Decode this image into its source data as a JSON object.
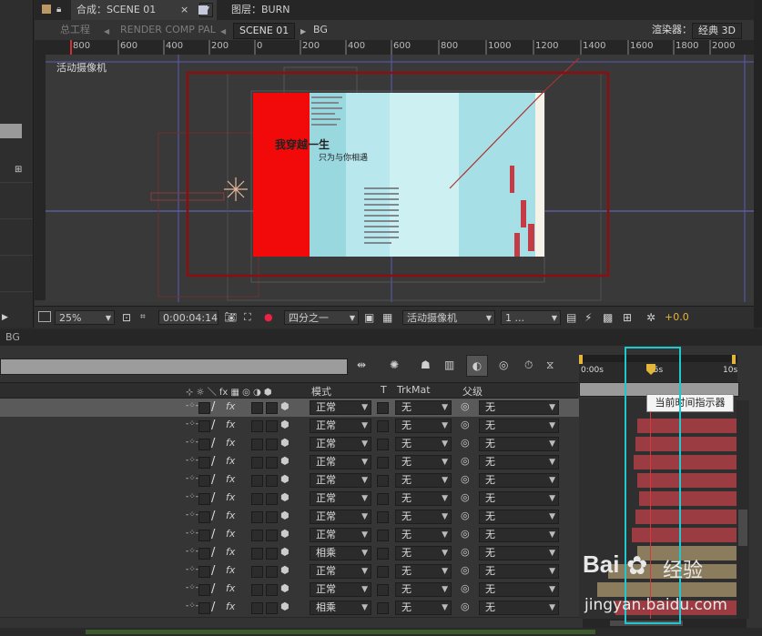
{
  "left_panel": {
    "icon": "hierarchy-icon"
  },
  "comp_panel": {
    "tab_comp": "合成：SCENE 01",
    "tab_layer": "图层：BURN",
    "nav": {
      "project": "总工程",
      "render": "RENDER COMP PAL",
      "current": "SCENE 01",
      "bg": "BG"
    },
    "renderer_label": "渲染器：",
    "renderer_value": "经典 3D",
    "ruler_ticks": [
      "800",
      "600",
      "400",
      "200",
      "0",
      "200",
      "400",
      "600",
      "800",
      "1000",
      "1200",
      "1400",
      "1600",
      "1800",
      "2000"
    ],
    "viewer_label": "活动摄像机",
    "artwork": {
      "title": "我穿越一生",
      "subtitle": "只为与你相遇"
    },
    "bottom_bar": {
      "zoom": "25%",
      "timecode": "0:00:04:14",
      "resolution": "四分之一",
      "camera": "活动摄像机",
      "views": "1 ...",
      "exposure": "+0.0"
    }
  },
  "timeline": {
    "tab_label": "BG",
    "time_labels": [
      "0:00s",
      "05s",
      "10s"
    ],
    "columns": {
      "mode": "模式",
      "t": "T",
      "trkmat": "TrkMat",
      "parent": "父级"
    },
    "tooltip": "当前时间指示器",
    "rows": [
      {
        "mode": "正常",
        "trkmat": "无",
        "parent": "无"
      },
      {
        "mode": "正常",
        "trkmat": "无",
        "parent": "无"
      },
      {
        "mode": "正常",
        "trkmat": "无",
        "parent": "无"
      },
      {
        "mode": "正常",
        "trkmat": "无",
        "parent": "无"
      },
      {
        "mode": "正常",
        "trkmat": "无",
        "parent": "无"
      },
      {
        "mode": "正常",
        "trkmat": "无",
        "parent": "无"
      },
      {
        "mode": "正常",
        "trkmat": "无",
        "parent": "无"
      },
      {
        "mode": "正常",
        "trkmat": "无",
        "parent": "无"
      },
      {
        "mode": "相乘",
        "trkmat": "无",
        "parent": "无"
      },
      {
        "mode": "正常",
        "trkmat": "无",
        "parent": "无"
      },
      {
        "mode": "正常",
        "trkmat": "无",
        "parent": "无"
      },
      {
        "mode": "相乘",
        "trkmat": "无",
        "parent": "无"
      }
    ]
  },
  "watermark": {
    "brand": "Bai",
    "brand2": "经验",
    "url": "jingyan.baidu.com"
  },
  "colors": {
    "highlight": "#22c6cf",
    "accent_yellow": "#e3b53a",
    "current_time_line": "#d63b3b"
  }
}
